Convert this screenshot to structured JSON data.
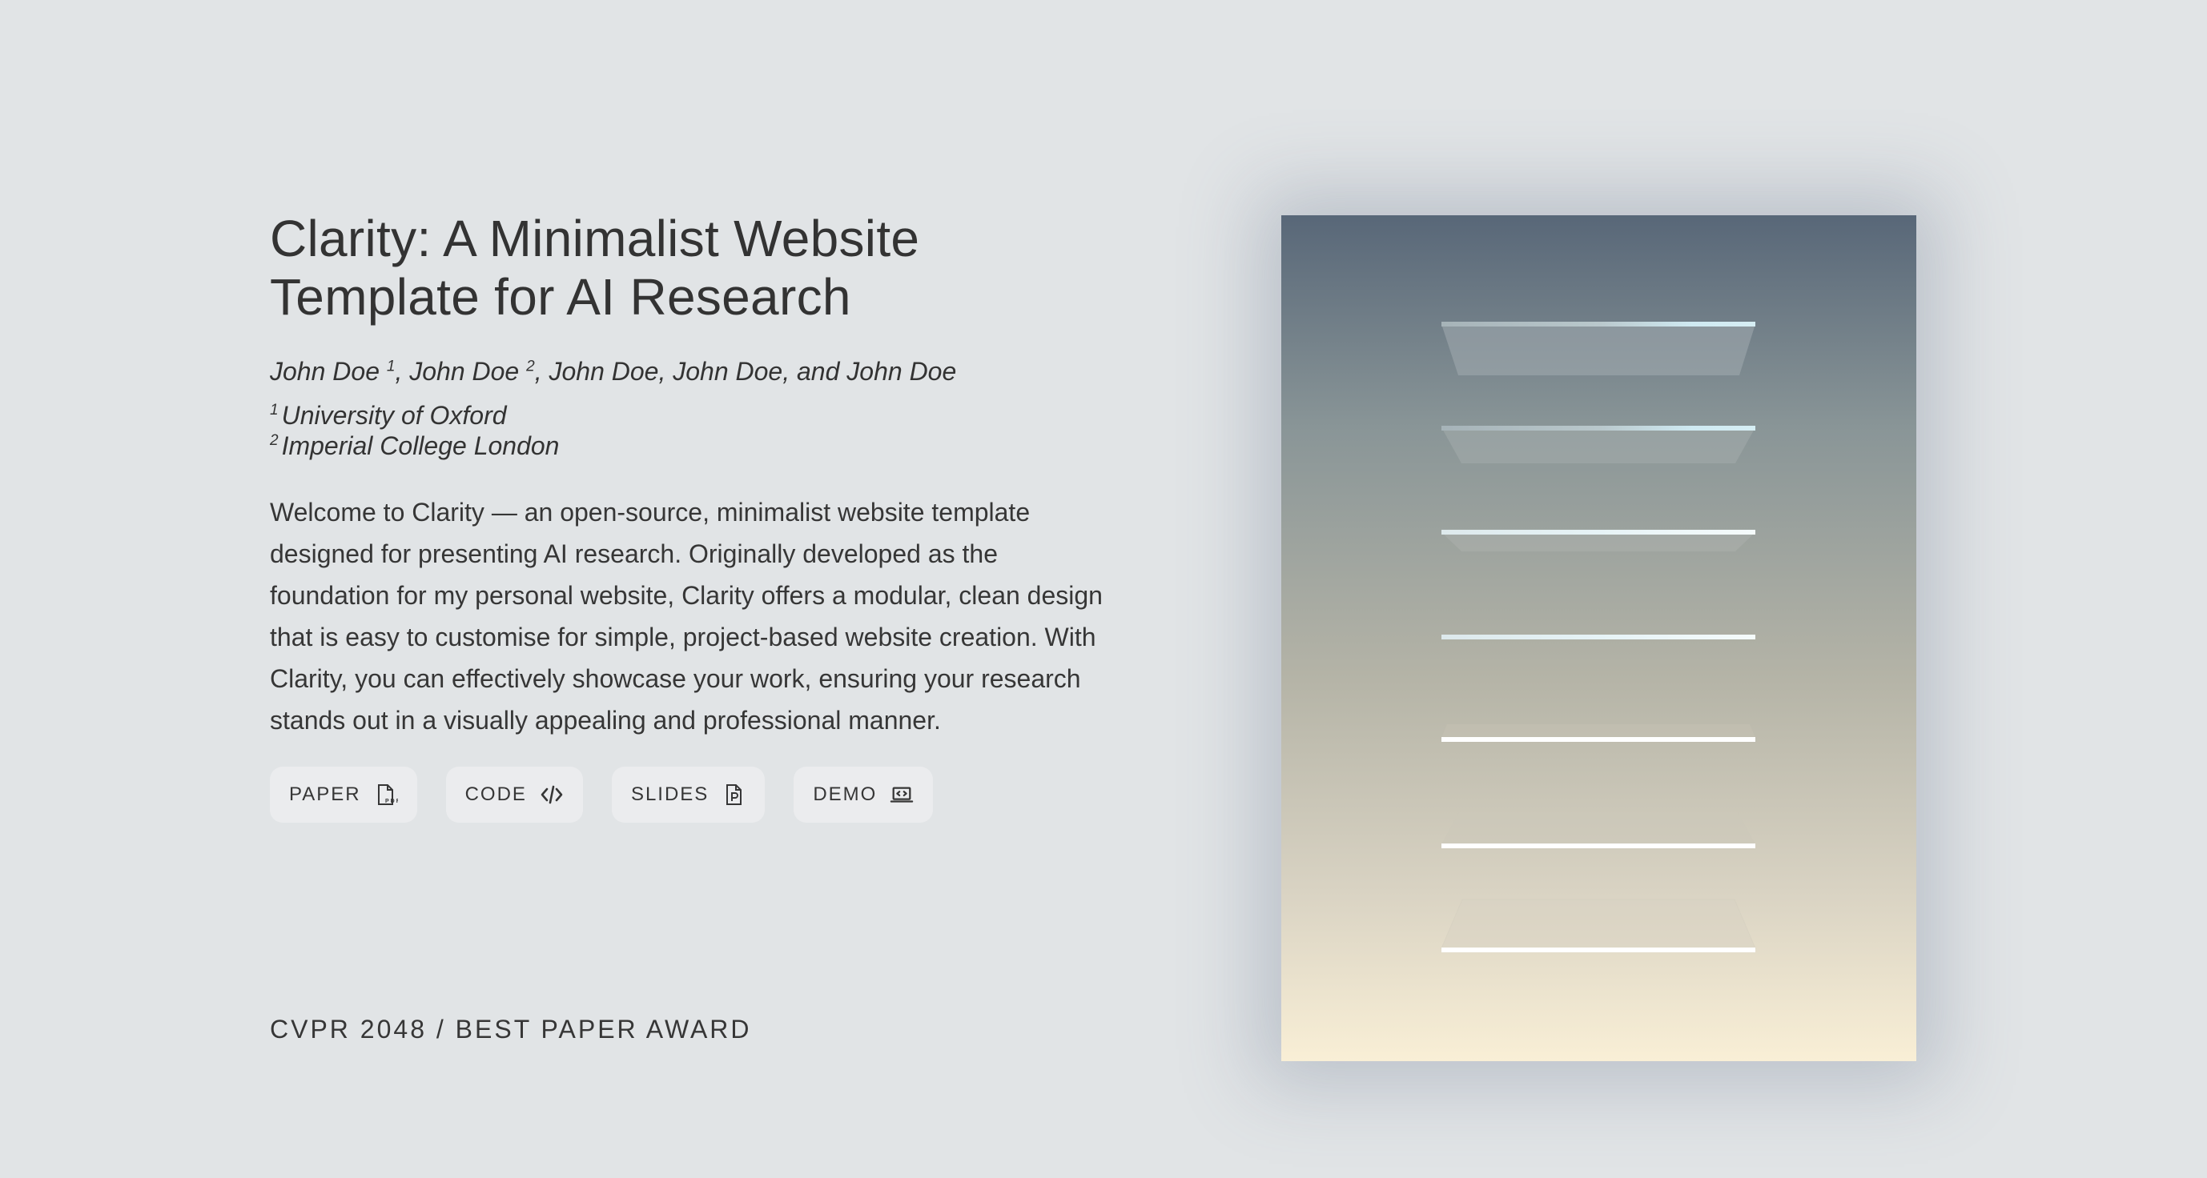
{
  "header": {
    "title_line1": "Clarity: A Minimalist Website",
    "title_line2": "Template for AI Research"
  },
  "authors": [
    {
      "name": "John Doe",
      "sup": "1"
    },
    {
      "name": "John Doe",
      "sup": "2"
    },
    {
      "name": "John Doe",
      "sup": ""
    },
    {
      "name": "John Doe",
      "sup": ""
    },
    {
      "name": "John Doe",
      "sup": ""
    }
  ],
  "authors_text": {
    "a1": "John Doe ",
    "s1": "1",
    "a2": ", John Doe ",
    "s2": "2",
    "a3": ", John Doe, John Doe, and John Doe"
  },
  "affiliations": [
    {
      "sup": "1",
      "name": "University of Oxford"
    },
    {
      "sup": "2",
      "name": "Imperial College London"
    }
  ],
  "abstract": "Welcome to Clarity — an open-source, minimalist website template designed for presenting AI research. Originally developed as the foundation for my personal website, Clarity offers a modular, clean design that is easy to customise for simple, project-based website creation. With Clarity, you can effectively showcase your work, ensuring your research stands out in a visually appealing and professional manner.",
  "buttons": [
    {
      "label": "PAPER",
      "icon": "pdf-file-icon"
    },
    {
      "label": "CODE",
      "icon": "code-icon"
    },
    {
      "label": "SLIDES",
      "icon": "slides-file-icon"
    },
    {
      "label": "DEMO",
      "icon": "laptop-code-icon"
    }
  ],
  "venue": "CVPR 2048 / BEST PAPER AWARD",
  "colors": {
    "background": "#e1e4e6",
    "text": "#363636",
    "button_bg": "#ebecee",
    "figure_top": "#586778",
    "figure_bottom": "#f9efd6"
  }
}
